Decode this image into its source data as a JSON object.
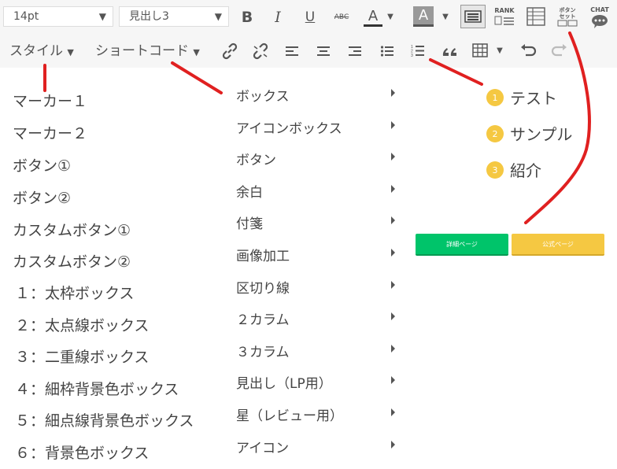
{
  "toolbar": {
    "font_size": "14pt",
    "block_format": "見出し3",
    "bold": "B",
    "italic": "I",
    "underline": "U",
    "strike": "ABC",
    "text_color": "A",
    "bg_color": "A",
    "rank_label": "RANK",
    "button_set_label_1": "ボタン",
    "button_set_label_2": "セット",
    "chat_label": "CHAT",
    "style_menu": "スタイル",
    "shortcode_menu": "ショートコード"
  },
  "style_menu_items": [
    "マーカー１",
    "マーカー２",
    "ボタン①",
    "ボタン②",
    "カスタムボタン①",
    "カスタムボタン②",
    "１：太枠ボックス",
    "２：太点線ボックス",
    "３：二重線ボックス",
    "４：細枠背景色ボックス",
    "５：細点線背景色ボックス",
    "６：背景色ボックス"
  ],
  "shortcode_menu_items": [
    "ボックス",
    "アイコンボックス",
    "ボタン",
    "余白",
    "付箋",
    "画像加工",
    "区切り線",
    "２カラム",
    "３カラム",
    "見出し（LP用）",
    "星（レビュー用）",
    "アイコン"
  ],
  "numbered_list": [
    {
      "num": "1",
      "text": "テスト"
    },
    {
      "num": "2",
      "text": "サンプル"
    },
    {
      "num": "3",
      "text": "紹介"
    }
  ],
  "button_set": {
    "left_label": "詳細ページ",
    "right_label": "公式ページ"
  },
  "colors": {
    "badge": "#f5c842",
    "green_button": "#00c46a",
    "yellow_button": "#f5c842",
    "annotation": "#e02020"
  }
}
